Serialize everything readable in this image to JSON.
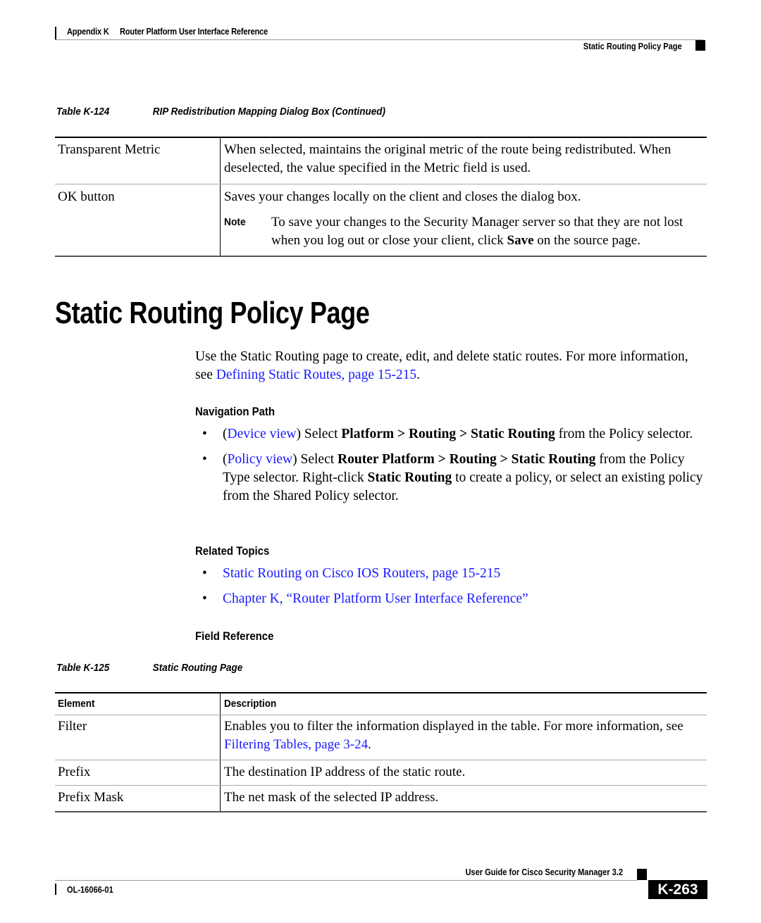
{
  "header": {
    "appendix": "Appendix K",
    "chapter_title": "Router Platform User Interface Reference",
    "section": "Static Routing Policy Page"
  },
  "table_k124": {
    "caption_number": "Table K-124",
    "caption_title": "RIP Redistribution Mapping Dialog Box (Continued)",
    "rows": [
      {
        "element": "Transparent Metric",
        "description": "When selected, maintains the original metric of the route being redistributed. When deselected, the value specified in the Metric field is used."
      },
      {
        "element": "OK button",
        "description": "Saves your changes locally on the client and closes the dialog box.",
        "note": {
          "label": "Note",
          "text_before": "To save your changes to the Security Manager server so that they are not lost when you log out or close your client, click ",
          "bold": "Save",
          "text_after": " on the source page."
        }
      }
    ]
  },
  "page_title": "Static Routing Policy Page",
  "intro": {
    "text": "Use the Static Routing page to create, edit, and delete static routes. For more information, see ",
    "link": "Defining Static Routes, page 15-215",
    "end": "."
  },
  "navigation_path": {
    "heading": "Navigation Path",
    "items": [
      {
        "link": "Device view",
        "t1": ") Select ",
        "b1": "Platform > Routing > Static Routing",
        "t2": " from the Policy selector."
      },
      {
        "link": "Policy view",
        "t1": ") Select ",
        "b1": "Router Platform > Routing > Static Routing",
        "t2": " from the Policy Type selector. Right-click ",
        "b2": "Static Routing",
        "t3": " to create a policy, or select an existing policy from the Shared Policy selector."
      }
    ]
  },
  "related_topics": {
    "heading": "Related Topics",
    "items": [
      "Static Routing on Cisco IOS Routers, page 15-215",
      "Chapter K, “Router Platform User Interface Reference”"
    ]
  },
  "field_reference": {
    "heading": "Field Reference"
  },
  "table_k125": {
    "caption_number": "Table K-125",
    "caption_title": "Static Routing Page",
    "headers": [
      "Element",
      "Description"
    ],
    "rows": [
      {
        "element": "Filter",
        "description": "Enables you to filter the information displayed in the table. For more information, see ",
        "link": "Filtering Tables, page 3-24",
        "end": "."
      },
      {
        "element": "Prefix",
        "description": "The destination IP address of the static route."
      },
      {
        "element": "Prefix Mask",
        "description": "The net mask of the selected IP address."
      }
    ]
  },
  "footer": {
    "guide_title": "User Guide for Cisco Security Manager 3.2",
    "doc_number": "OL-16066-01",
    "page_number": "K-263"
  },
  "colors": {
    "link": "#1a1aff",
    "text": "#000000"
  }
}
